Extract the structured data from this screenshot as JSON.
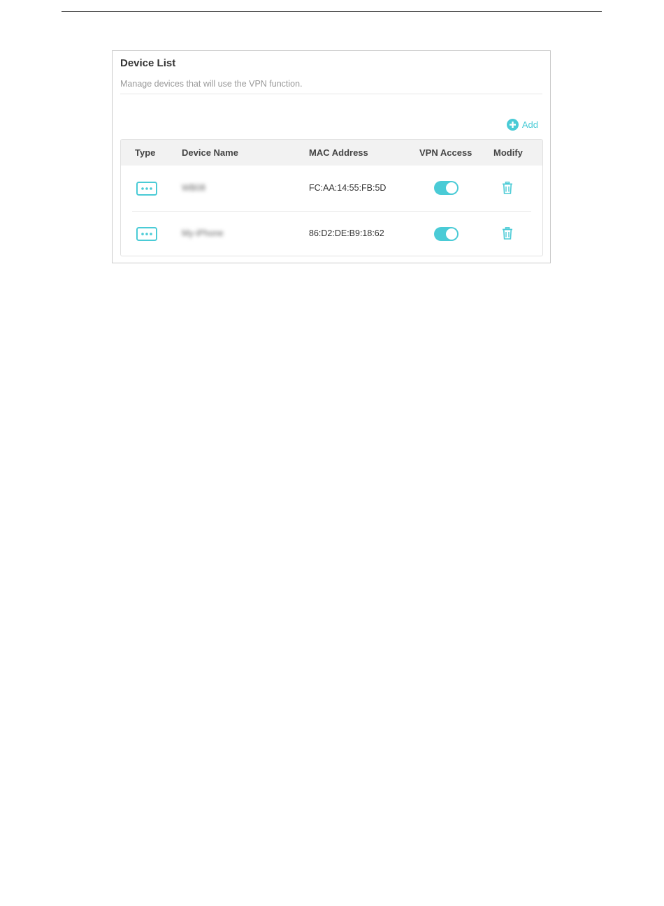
{
  "panel": {
    "title": "Device List",
    "description": "Manage devices that will use the VPN function."
  },
  "actions": {
    "add_label": "Add"
  },
  "table": {
    "columns": [
      "Type",
      "Device Name",
      "MAC Address",
      "VPN Access",
      "Modify"
    ],
    "rows": [
      {
        "type_icon": "more-dots-icon",
        "device_name": "WB08",
        "mac": "FC:AA:14:55:FB:5D",
        "vpn_access": true
      },
      {
        "type_icon": "more-dots-icon",
        "device_name": "My-iPhone",
        "mac": "86:D2:DE:B9:18:62",
        "vpn_access": true
      }
    ]
  },
  "colors": {
    "accent": "#4acbd6",
    "header_bg": "#f2f2f2",
    "border": "#c9c9c9"
  }
}
